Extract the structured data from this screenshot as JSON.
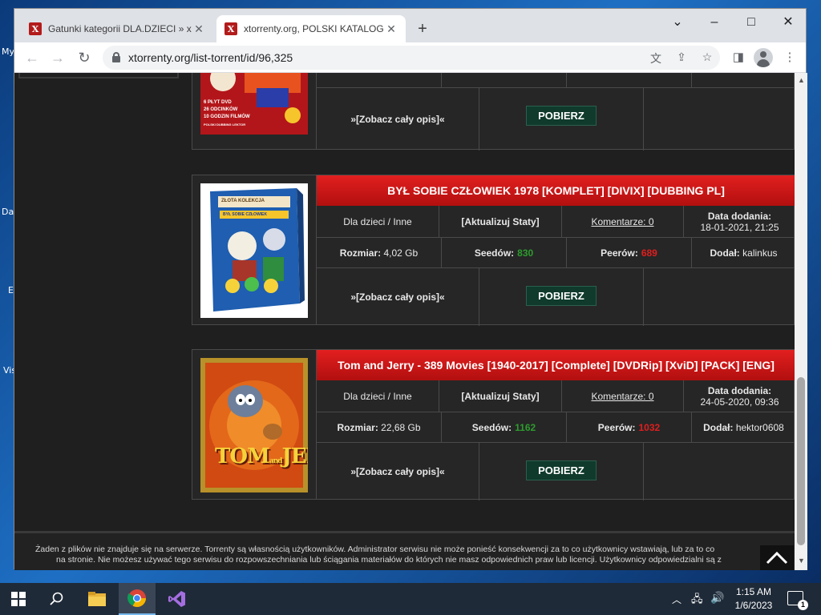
{
  "desktop": {
    "fragments": [
      "My",
      "Da",
      "E",
      "Vis"
    ]
  },
  "browser": {
    "tabs": [
      {
        "title": "Gatunki kategorii DLA.DZIECI » x",
        "favicon": "X"
      },
      {
        "title": "xtorrenty.org, POLSKI KATALOG T",
        "favicon": "X"
      }
    ],
    "new_tab": "+",
    "controls": {
      "dropdown": "⌄",
      "minimize": "–",
      "maximize": "□",
      "close": "✕"
    },
    "url": "xtorrenty.org/list-torrent/id/96,325"
  },
  "torrents": [
    {
      "title": "",
      "opis": "»[Zobacz cały opis]«",
      "download": "POBIERZ",
      "cover": {
        "lines": [
          "6 PŁYT DVD",
          "26 ODCINKÓW",
          "10 GODZIN FILMÓW",
          "POLSKI DUBBING LEKTOR"
        ]
      }
    },
    {
      "title": "BYŁ SOBIE CZŁOWIEK 1978 [KOMPLET] [DIVIX] [DUBBING PL]",
      "category": "Dla dzieci / Inne",
      "update": "[Aktualizuj Staty]",
      "comments": "Komentarze: 0",
      "date_label": "Data dodania:",
      "date": "18-01-2021, 21:25",
      "size_label": "Rozmiar:",
      "size": "4,02 Gb",
      "seed_label": "Seedów:",
      "seeds": "830",
      "peer_label": "Peerów:",
      "peers": "689",
      "added_label": "Dodał:",
      "added_by": "kalinkus",
      "opis": "»[Zobacz cały opis]«",
      "download": "POBIERZ",
      "cover": {
        "lines": [
          "ZŁOTA KOLEKCJA",
          "BYŁ SOBIE CZŁOWIEK"
        ]
      }
    },
    {
      "title": "Tom and Jerry - 389 Movies [1940-2017] [Complete] [DVDRip] [XviD] [PACK] [ENG]",
      "category": "Dla dzieci / Inne",
      "update": "[Aktualizuj Staty]",
      "comments": "Komentarze: 0",
      "date_label": "Data dodania:",
      "date": "24-05-2020, 09:36",
      "size_label": "Rozmiar:",
      "size": "22,68 Gb",
      "seed_label": "Seedów:",
      "seeds": "1162",
      "peer_label": "Peerów:",
      "peers": "1032",
      "added_label": "Dodał:",
      "added_by": "hektor0608",
      "opis": "»[Zobacz cały opis]«",
      "download": "POBIERZ",
      "cover": {
        "lines": [
          "TOM",
          "and",
          "JERRY"
        ]
      }
    }
  ],
  "footer": {
    "line1": "Żaden z plików nie znajduje się na serwerze. Torrenty są własnością użytkowników. Administrator serwisu nie może ponieść konsekwencji za to co użytkownicy wstawiają, lub za to co",
    "line2": "na stronie. Nie możesz używać tego serwisu do rozpowszechniania lub ściągania materiałów do których nie masz odpowiednich praw lub licencji. Użytkownicy odpowiedzialni są z"
  },
  "taskbar": {
    "time": "1:15 AM",
    "date": "1/6/2023",
    "notification_count": "1"
  },
  "colors": {
    "title_red": "#d81818",
    "seed_green": "#2e9c2e",
    "peer_red": "#e01e1e",
    "button_green": "#0f3a2c"
  }
}
